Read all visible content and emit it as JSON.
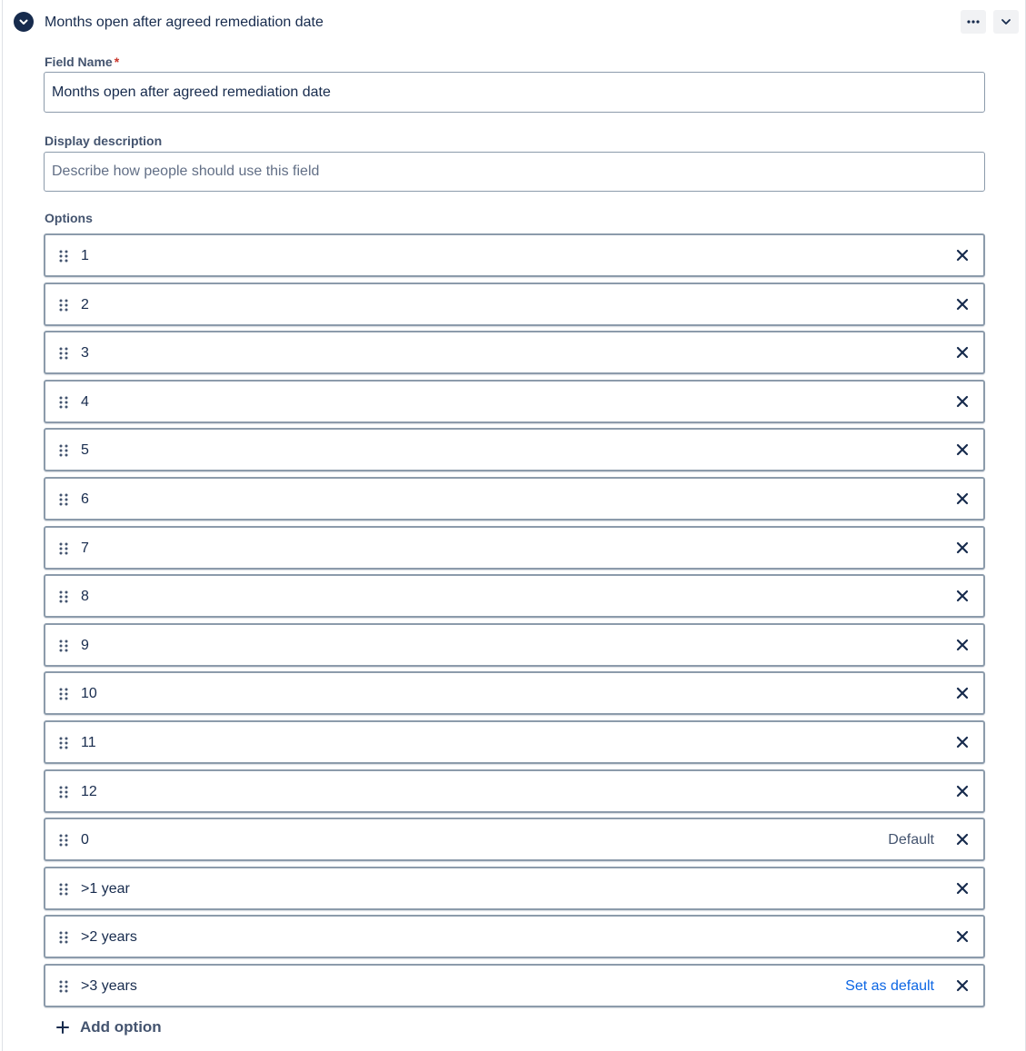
{
  "header": {
    "title": "Months open after agreed remediation date",
    "toggle_icon": "chevron-down-circle-icon",
    "more_icon": "more-horizontal-icon",
    "collapse_icon": "chevron-down-icon"
  },
  "field_name": {
    "label": "Field Name",
    "required_marker": "*",
    "value": "Months open after agreed remediation date"
  },
  "display_description": {
    "label": "Display description",
    "placeholder": "Describe how people should use this field",
    "value": ""
  },
  "options": {
    "label": "Options",
    "items": [
      {
        "label": "1"
      },
      {
        "label": "2"
      },
      {
        "label": "3"
      },
      {
        "label": "4"
      },
      {
        "label": "5"
      },
      {
        "label": "6"
      },
      {
        "label": "7"
      },
      {
        "label": "8"
      },
      {
        "label": "9"
      },
      {
        "label": "10"
      },
      {
        "label": "11"
      },
      {
        "label": "12"
      },
      {
        "label": "0",
        "badge": "Default"
      },
      {
        "label": ">1 year"
      },
      {
        "label": ">2 years"
      },
      {
        "label": ">3 years",
        "action": "Set as default"
      }
    ],
    "add_label": "Add option"
  },
  "colors": {
    "text": "#172b4d",
    "subtle_text": "#44546f",
    "link": "#0c66e4",
    "border": "#8c9bab",
    "required": "#c9372c"
  }
}
